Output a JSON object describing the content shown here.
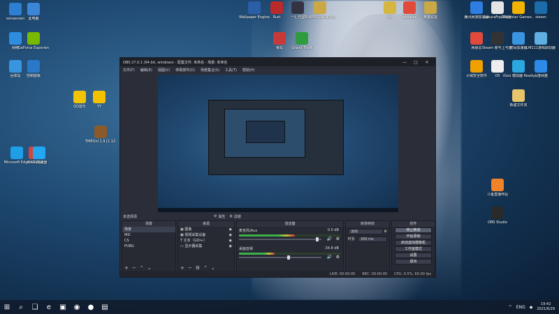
{
  "desktop_icons_left": [
    {
      "label": "sensensen",
      "color": "#2d7fd1"
    },
    {
      "label": "此电脑",
      "color": "#3b86d6"
    },
    {
      "label": "网络",
      "color": "#2f8de0"
    },
    {
      "label": "GeForce Experience",
      "color": "#76b900"
    },
    {
      "label": "回收站",
      "color": "#3a95e0"
    },
    {
      "label": "控制面板",
      "color": "#2a78c8"
    },
    {
      "label": "QQ音乐",
      "color": "#f2c300"
    },
    {
      "label": "YY",
      "color": "#f5c000"
    },
    {
      "label": "Microsoft Edge",
      "color": "#1f9ee8"
    },
    {
      "label": "WeGame",
      "color": "#d4453c"
    },
    {
      "label": "TMEOnl 1.9 [1.12.2] 20...",
      "color": "#8b5a2b"
    },
    {
      "label": "UU加速器",
      "color": "#23a7f2"
    }
  ],
  "desktop_icons_top": [
    {
      "label": "Wallpaper Engine",
      "color": "#2a5fa8"
    },
    {
      "label": "Rust",
      "color": "#bb2a2a"
    },
    {
      "label": "一汇元宝",
      "color": "#334"
    },
    {
      "label": "PLAYERUNKNOWN'S BATTLEGR...",
      "color": "#c9a845"
    },
    {
      "label": "ipu",
      "color": "#d5b640"
    },
    {
      "label": "wegame",
      "color": "#e14a3a"
    },
    {
      "label": "英雄联盟",
      "color": "#c9a845"
    },
    {
      "label": "赛车",
      "color": "#c83a3a"
    },
    {
      "label": "Grand Theft",
      "color": "#2e9b3e"
    }
  ],
  "desktop_icons_right": [
    {
      "label": "騰讯网游加速器",
      "color": "#2e7de0"
    },
    {
      "label": "SakuraFrp启动器",
      "color": "#e5e5e5"
    },
    {
      "label": "Rockstar Games...",
      "color": "#f1b300"
    },
    {
      "label": "steam",
      "color": "#1b6ca8"
    },
    {
      "label": "网易云",
      "color": "#e14a3a"
    },
    {
      "label": "Steam 账号上号器 3.2",
      "color": "#333"
    },
    {
      "label": "密码加速器",
      "color": "#3a95e0"
    },
    {
      "label": "LM111游戏启动器",
      "color": "#5fb0e0"
    },
    {
      "label": "火绒安全软件",
      "color": "#f0a000"
    },
    {
      "label": "OX",
      "color": "#eee"
    },
    {
      "label": "iGoo 模拟器 Ready ...",
      "color": "#2ca8e0"
    },
    {
      "label": "百度网盘",
      "color": "#2c8ae8"
    },
    {
      "label": "新建文件夹",
      "color": "#e8c46a"
    },
    {
      "label": "斗鱼直播伴侣",
      "color": "#f0822a"
    },
    {
      "label": "OBS Studio",
      "color": "#2a2a2a"
    }
  ],
  "obs": {
    "title": "OBS 27.0.1 (64-bit, windows) - 配置文件: 未命名 - 场景: 未命名",
    "menu": [
      "文件(F)",
      "编辑(E)",
      "视图(V)",
      "停靠部件(D)",
      "场景集合(S)",
      "工具(T)",
      "帮助(H)"
    ],
    "window_buttons": [
      "—",
      "□",
      "✕"
    ],
    "source_bar_label": "未选择源",
    "source_bar_props": "属性",
    "source_bar_filters": "滤镜",
    "docks": {
      "scenes_header": "场景",
      "sources_header": "来源",
      "mixer_header": "混音器",
      "transitions_header": "转场特效",
      "controls_header": "控件"
    },
    "scenes": [
      "场景",
      "MIC",
      "CS",
      "PUBG"
    ],
    "sources": [
      "图像",
      "视频采集设备",
      "文本（GDI+）",
      "显示器采集"
    ],
    "mixer": [
      {
        "name": "麦克风/Aux",
        "db": "0.0 dB",
        "level": 0.55,
        "volume": 0.95
      },
      {
        "name": "桌面音频",
        "db": "-34.8 dB",
        "level": 0.35,
        "volume": 0.6
      }
    ],
    "transition": {
      "type": "淡出",
      "duration_label": "时长",
      "duration_value": "300 ms"
    },
    "controls": [
      "停止推流",
      "开始录制",
      "启动虚拟摄像机",
      "工作室模式",
      "设置",
      "退出"
    ],
    "status": {
      "live": "LIVE: 00:00:00",
      "rec": "REC: 00:00:00",
      "cpu": "CPU: 0.5%, 60.00 fps"
    }
  },
  "taskbar": {
    "apps": [
      "⊞",
      "⌕",
      "❏",
      "e",
      "▣",
      "◉",
      "●",
      "▤"
    ],
    "tray": [
      "^",
      "ENG",
      "◆"
    ],
    "time": "19:42",
    "date": "2021/6/29"
  }
}
